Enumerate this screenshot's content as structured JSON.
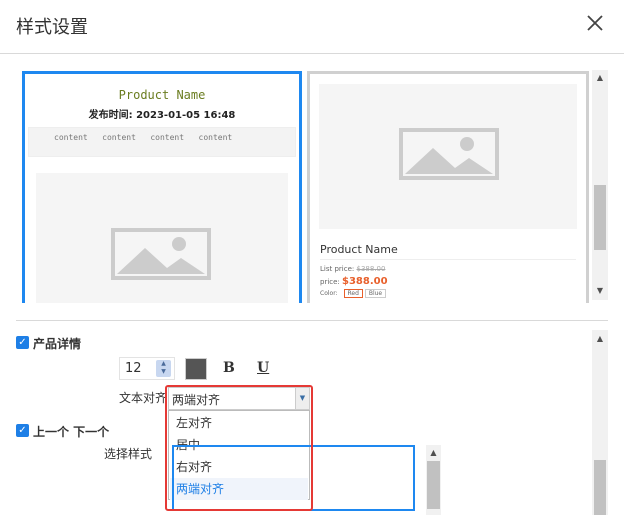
{
  "dialog": {
    "title": "样式设置",
    "close_icon": "close-icon"
  },
  "preview_left": {
    "product_name": "Product Name",
    "publish_time": "发布时间: 2023-01-05 16:48",
    "tabs": [
      "content",
      "content",
      "content",
      "content"
    ],
    "image_icon": "image-placeholder-icon"
  },
  "preview_right": {
    "product_name": "Product Name",
    "list_price_label": "List price:",
    "list_price": "$388.00",
    "price_label": "price:",
    "price": "$388.00",
    "color_label": "Color:",
    "colors": [
      "Red",
      "Blue"
    ],
    "image_icon": "image-placeholder-icon"
  },
  "product_detail": {
    "label": "产品详情",
    "checked": true,
    "font_size": "12",
    "color": "#555555",
    "bold_label": "B",
    "underline_label": "U",
    "align_label": "文本对齐",
    "align_value": "两端对齐",
    "align_options": [
      "左对齐",
      "居中",
      "右对齐",
      "两端对齐"
    ],
    "selected_index": 3
  },
  "prev_next": {
    "label": "上一个 下一个",
    "checked": true,
    "style_label": "选择样式"
  },
  "colors": {
    "accent": "#1e88f0",
    "highlight": "#e53935",
    "price": "#e8602c"
  }
}
